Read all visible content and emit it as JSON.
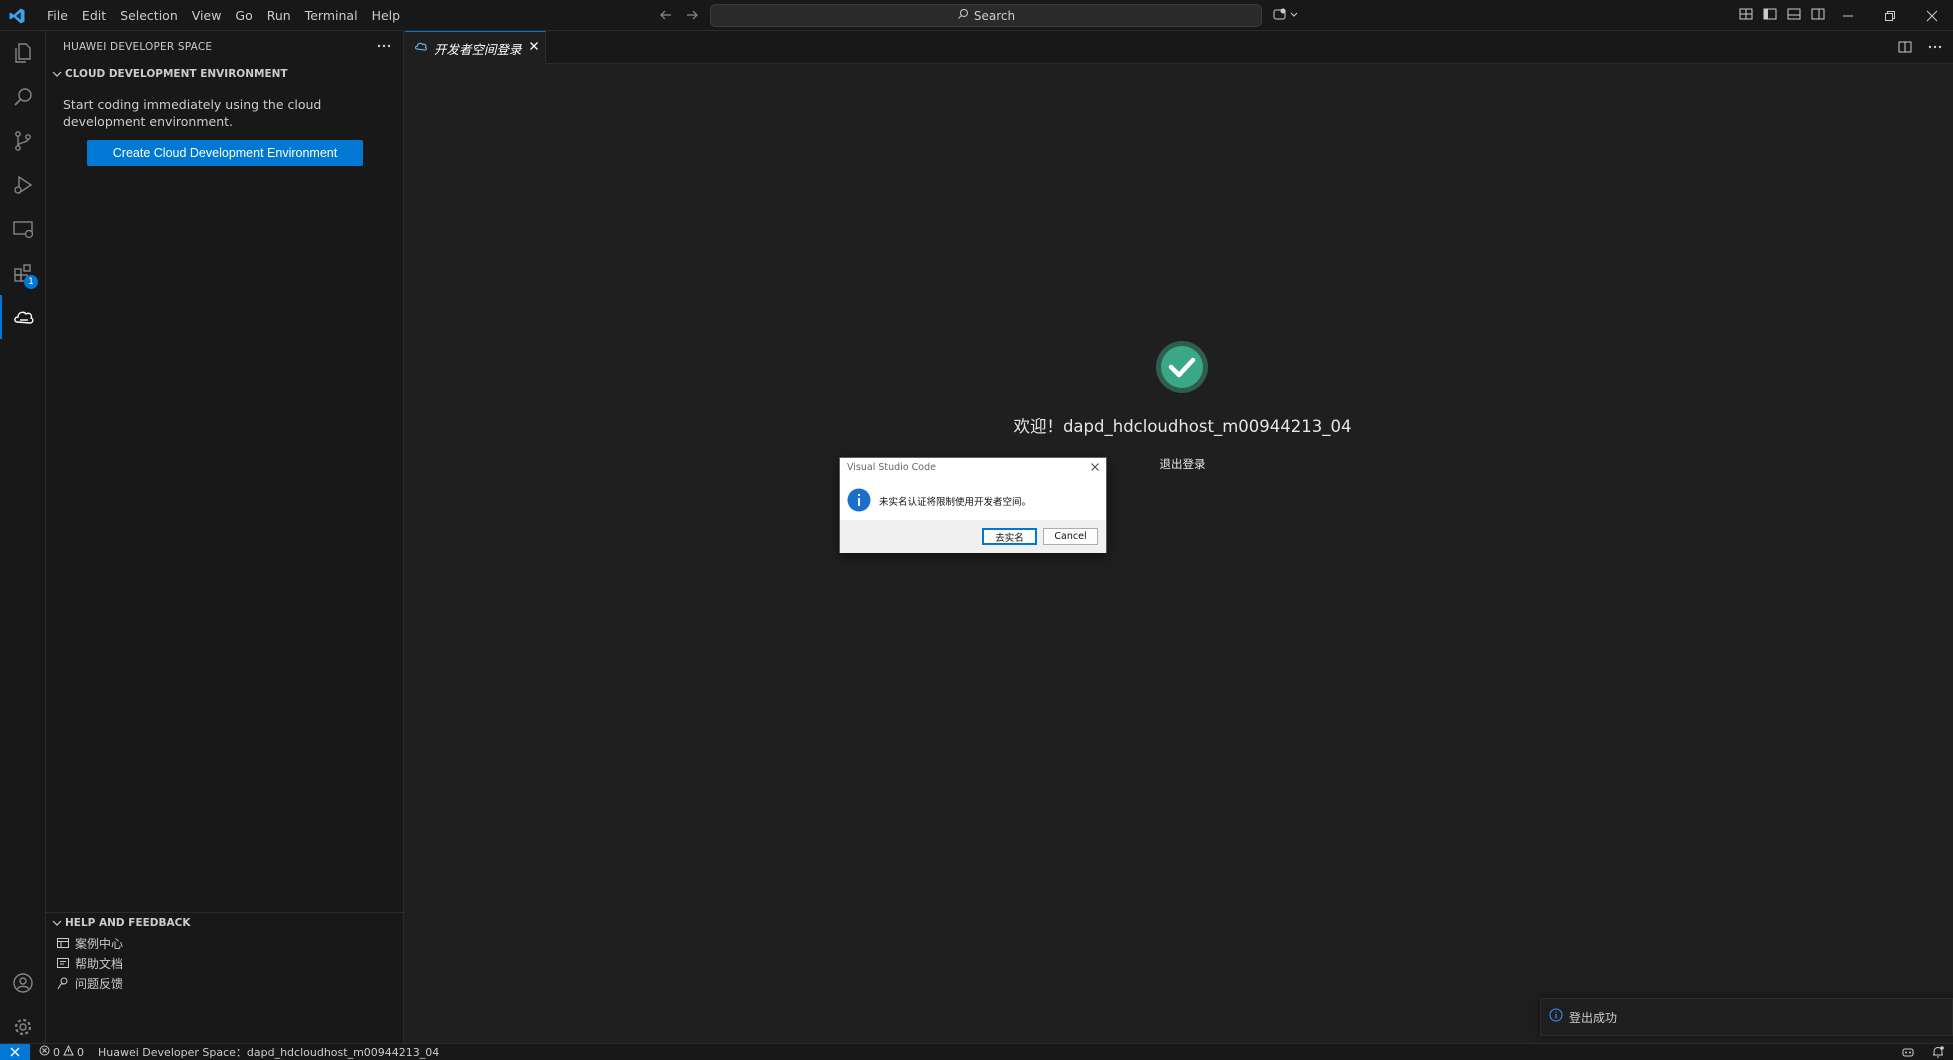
{
  "menu": [
    "File",
    "Edit",
    "Selection",
    "View",
    "Go",
    "Run",
    "Terminal",
    "Help"
  ],
  "search": {
    "label": "Search"
  },
  "activity": {
    "extensions_badge": "1"
  },
  "sidebar": {
    "title": "HUAWEI DEVELOPER SPACE",
    "section_cloud": "CLOUD DEVELOPMENT ENVIRONMENT",
    "description": "Start coding immediately using the cloud development environment.",
    "create_button": "Create Cloud Development Environment",
    "section_help": "HELP AND FEEDBACK",
    "help_items": [
      "案例中心",
      "帮助文档",
      "问题反馈"
    ]
  },
  "tab": {
    "label": "开发者空间登录"
  },
  "editor": {
    "welcome": "欢迎！dapd_hdcloudhost_m00944213_04",
    "logout": "退出登录"
  },
  "dialog": {
    "title": "Visual Studio Code",
    "message": "未实名认证将限制使用开发者空间。",
    "primary_button": "去实名",
    "cancel_button": "Cancel"
  },
  "toast": {
    "message": "登出成功"
  },
  "statusbar": {
    "errors": "0",
    "warnings": "0",
    "space": "Huawei Developer Space：dapd_hdcloudhost_m00944213_04"
  },
  "colors": {
    "accent": "#0078d4",
    "success": "#4ec9a8",
    "background": "#1f1f1f"
  }
}
